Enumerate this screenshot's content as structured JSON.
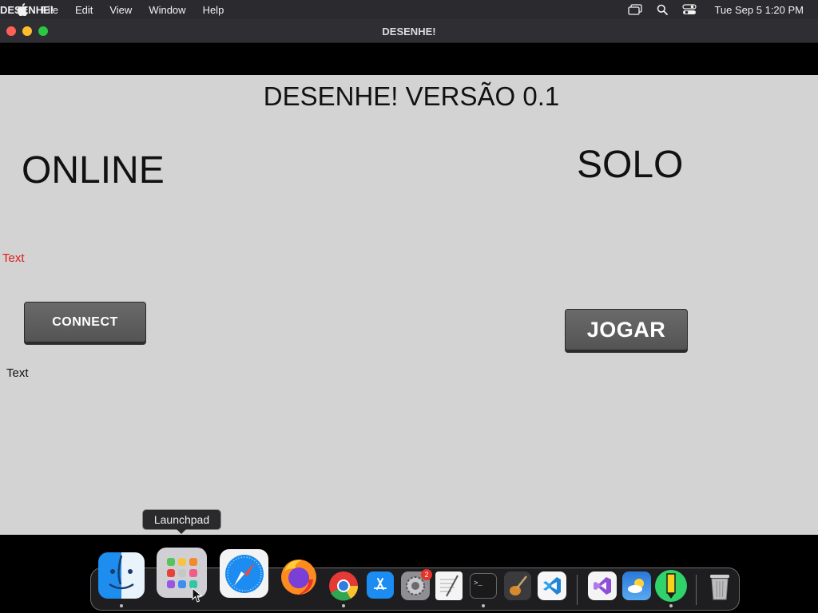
{
  "menubar": {
    "app_name": "DESENHE!",
    "items": [
      "File",
      "Edit",
      "View",
      "Window",
      "Help"
    ],
    "clock": "Tue Sep 5  1:20 PM"
  },
  "window": {
    "title": "DESENHE!"
  },
  "game": {
    "title": "DESENHE! VERSÃO 0.1",
    "online_label": "ONLINE",
    "solo_label": "SOLO",
    "status_text_red": "Text",
    "connect_label": "CONNECT",
    "status_text": "Text",
    "jogar_label": "JOGAR"
  },
  "dock": {
    "tooltip": "Launchpad",
    "apps": [
      "finder",
      "launchpad",
      "safari",
      "firefox",
      "chrome",
      "app-store",
      "system-settings",
      "textedit",
      "terminal",
      "instruments",
      "vscode",
      "visual-studio",
      "weather",
      "desenhe-app",
      "trash"
    ],
    "settings_badge": "2"
  },
  "colors": {
    "canvas_bg": "#d3d3d3",
    "status_red": "#e01b1b",
    "button_bg": "#5f5f5f"
  }
}
